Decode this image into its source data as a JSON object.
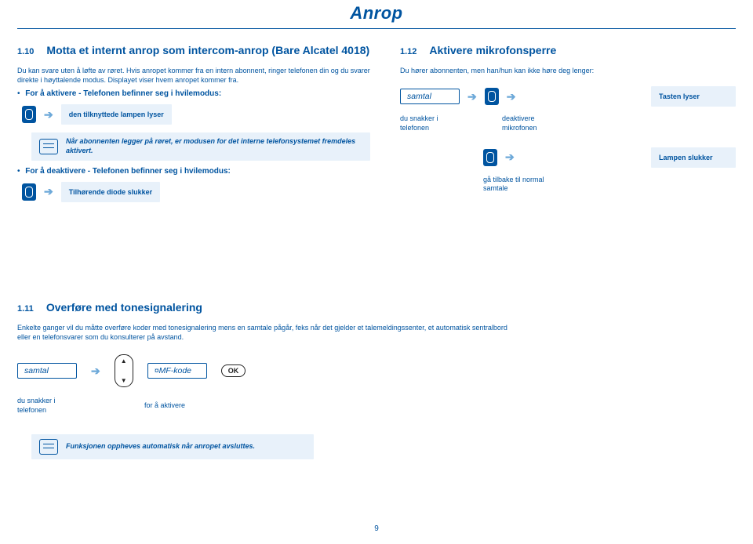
{
  "page": {
    "title": "Anrop",
    "number": "9"
  },
  "sec110": {
    "num": "1.10",
    "title": "Motta et internt anrop som intercom-anrop (Bare Alcatel 4018)",
    "intro": "Du kan svare uten å løfte av røret. Hvis anropet kommer fra en intern abonnent, ringer telefonen din og du svarer direkte i høyttalende modus. Displayet viser hvem anropet kommer fra.",
    "activate": "For å aktivere - Telefonen befinner seg i hvilemodus:",
    "lamp_on": "den tilknyttede lampen lyser",
    "note": "Når abonnenten legger på røret, er modusen for det interne telefonsystemet fremdeles aktivert.",
    "deactivate": "For å deaktivere - Telefonen befinner seg i hvilemodus:",
    "diode_off": "Tilhørende diode slukker"
  },
  "sec112": {
    "num": "1.12",
    "title": "Aktivere mikrofonsperre",
    "intro": "Du hører abonnenten, men han/hun kan ikke høre deg lenger:",
    "samtal": "samtal",
    "tast_lyser": "Tasten lyser",
    "speak": "du snakker i telefonen",
    "deact_mic": "deaktivere mikrofonen",
    "lamp_off": "Lampen slukker",
    "back": "gå tilbake til normal samtale"
  },
  "sec111": {
    "num": "1.11",
    "title": "Overføre med tonesignalering",
    "intro": "Enkelte ganger vil du måtte overføre koder med tonesignalering mens en samtale pågår, feks når det gjelder et talemeldingssenter, et automatisk sentralbord eller en telefonsvarer som du konsulterer på avstand.",
    "samtal": "samtal",
    "mfcode": "¤MF-kode",
    "ok": "OK",
    "speak": "du snakker i telefonen",
    "to_activate": "for å aktivere",
    "note": "Funksjonen oppheves automatisk når anropet avsluttes."
  }
}
